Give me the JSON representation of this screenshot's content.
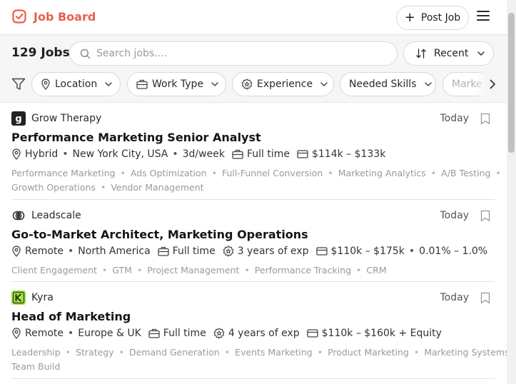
{
  "brand": {
    "name": "Job Board",
    "color": "#e8604c"
  },
  "header": {
    "post_job_label": "Post Job"
  },
  "list_header": {
    "count": "129 Jobs",
    "search_placeholder": "Search jobs....",
    "sort_label": "Recent"
  },
  "filters": [
    {
      "label": "Location",
      "icon": "location-pin-icon"
    },
    {
      "label": "Work Type",
      "icon": "briefcase-icon"
    },
    {
      "label": "Experience",
      "icon": "badge-icon"
    },
    {
      "label": "Needed Skills"
    },
    {
      "label": "Marke"
    }
  ],
  "jobs": [
    {
      "company": "Grow Therapy",
      "logo": "grow-therapy-logo",
      "date": "Today",
      "title": "Performance Marketing Senior Analyst",
      "meta": {
        "work_mode": "Hybrid",
        "location": "New York City, USA",
        "schedule": "3d/week",
        "employment": "Full time",
        "salary": "$114k – $133k"
      },
      "tags": [
        "Performance Marketing",
        "Ads Optimization",
        "Full-Funnel Conversion",
        "Marketing Analytics",
        "A/B Testing",
        "Growth Operations",
        "Vendor Management"
      ]
    },
    {
      "company": "Leadscale",
      "logo": "leadscale-logo",
      "date": "Today",
      "title": "Go-to-Market Architect, Marketing Operations",
      "meta": {
        "work_mode": "Remote",
        "location": "North America",
        "employment": "Full time",
        "experience": "3 years of exp",
        "salary": "$110k – $175k",
        "equity": "0.01% – 1.0%"
      },
      "tags": [
        "Client Engagement",
        "GTM",
        "Project Management",
        "Performance Tracking",
        "CRM"
      ]
    },
    {
      "company": "Kyra",
      "logo": "kyra-logo",
      "date": "Today",
      "title": "Head of Marketing",
      "meta": {
        "work_mode": "Remote",
        "location": "Europe & UK",
        "employment": "Full time",
        "experience": "4 years of exp",
        "salary": "$110k – $160k + Equity"
      },
      "tags": [
        "Leadership",
        "Strategy",
        "Demand Generation",
        "Events Marketing",
        "Product Marketing",
        "Marketing Systems",
        "Team Build"
      ]
    }
  ]
}
